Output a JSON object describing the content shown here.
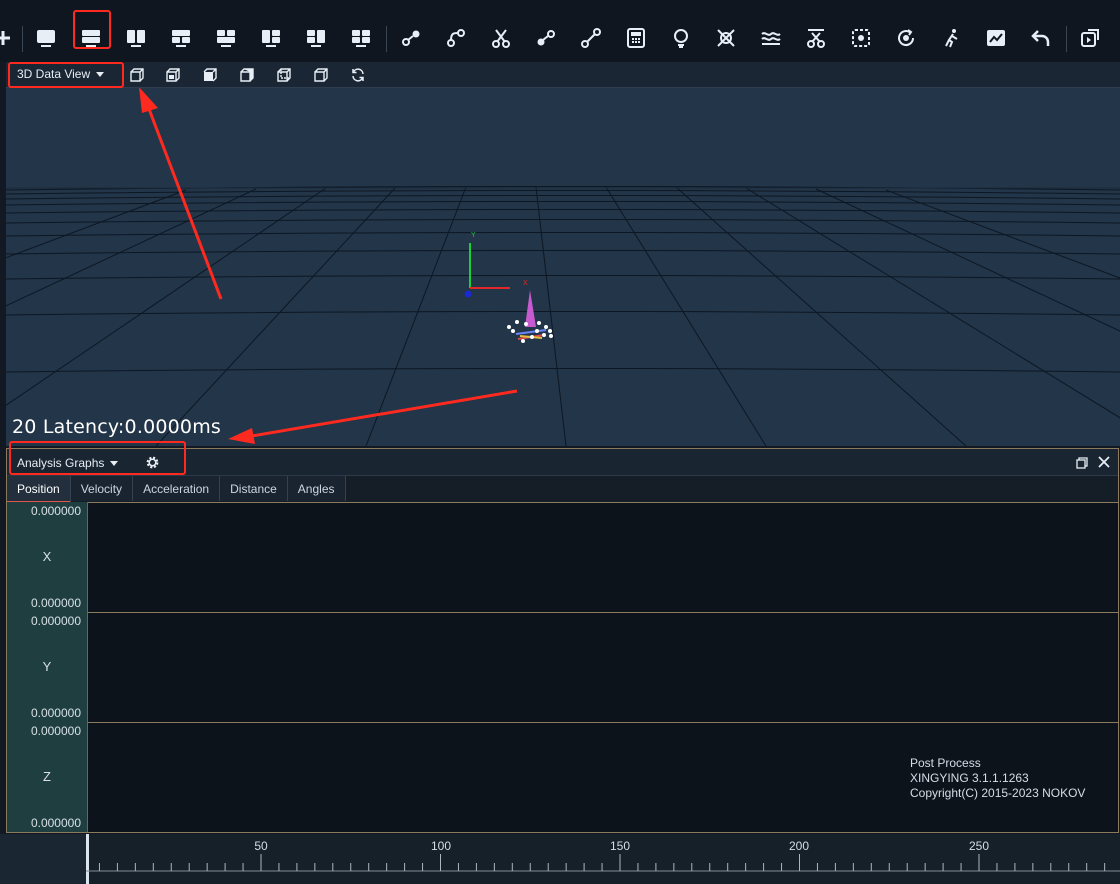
{
  "toolbar": {
    "icons": [
      "plus-icon",
      "single-view-icon",
      "horizontal-split-icon",
      "vertical-split-icon",
      "three-view-top-icon",
      "three-view-bottom-icon",
      "three-view-left-icon",
      "quad-view-icon",
      "point-link-icon",
      "curve-link-icon",
      "scissors-icon",
      "node-link-icon",
      "bone-link-icon",
      "calculator-icon",
      "lightbulb-icon",
      "crossed-target-icon",
      "wave-icon",
      "cut-marker-icon",
      "dotted-square-icon",
      "rotate-target-icon",
      "skeleton-run-icon",
      "line-graph-icon",
      "undo-icon",
      "export-icon"
    ]
  },
  "view3d": {
    "dropdown_label": "3D Data View",
    "view_icons": [
      "cube-front-icon",
      "cube-top-icon",
      "cube-side-icon",
      "cube-iso-icon",
      "cube-back-icon",
      "cube-perspective-icon",
      "reset-view-icon"
    ],
    "latency_text": "20 Latency:0.0000ms",
    "axis_labels": {
      "y": "Y",
      "x": "X"
    }
  },
  "analysis": {
    "dropdown_label": "Analysis Graphs",
    "tabs": [
      "Position",
      "Velocity",
      "Acceleration",
      "Distance",
      "Angles"
    ],
    "active_tab": "Position",
    "graphs": [
      {
        "axis": "X",
        "max": "0.000000",
        "min": "0.000000"
      },
      {
        "axis": "Y",
        "max": "0.000000",
        "min": "0.000000"
      },
      {
        "axis": "Z",
        "max": "0.000000",
        "min": "0.000000"
      }
    ],
    "info": [
      "Post Process",
      "XINGYING 3.1.1.1263",
      "Copyright(C) 2015-2023 NOKOV"
    ]
  },
  "timeline": {
    "labels": [
      "50",
      "100",
      "150",
      "200",
      "250"
    ]
  },
  "colors": {
    "highlight": "#ff2a1f",
    "arrow": "#ff2a1f",
    "accent_tab": "#e0564c"
  }
}
